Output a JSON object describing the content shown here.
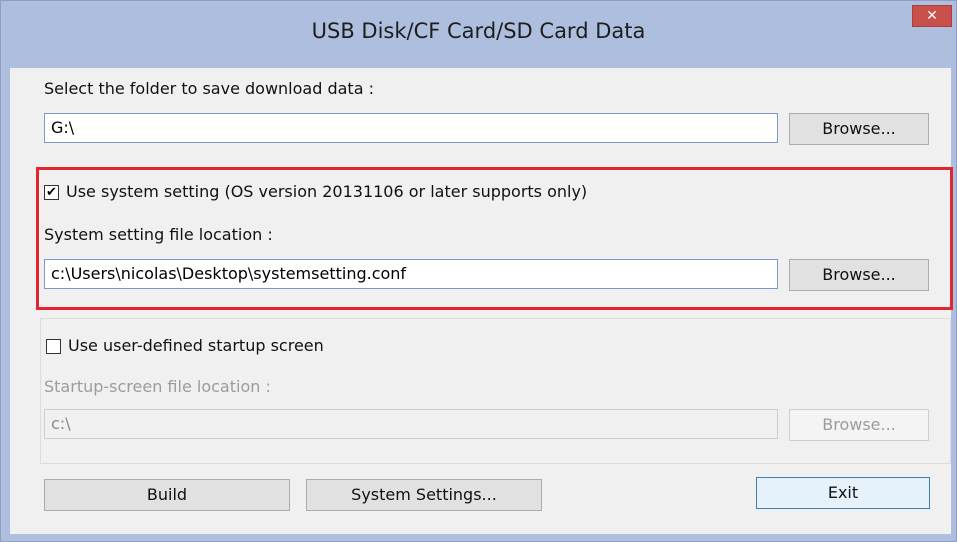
{
  "window": {
    "title": "USB Disk/CF Card/SD Card Data",
    "close_glyph": "✕"
  },
  "download": {
    "label": "Select the folder to save download data :",
    "value": "G:\\",
    "browse_label": "Browse..."
  },
  "system_setting": {
    "checkbox_label": "Use system setting (OS version 20131106 or later supports only)",
    "checked": true,
    "location_label": "System setting file location :",
    "value": "c:\\Users\\nicolas\\Desktop\\systemsetting.conf",
    "browse_label": "Browse..."
  },
  "startup": {
    "checkbox_label": "Use user-defined startup screen",
    "checked": false,
    "location_label": "Startup-screen file location :",
    "value": "c:\\",
    "browse_label": "Browse..."
  },
  "buttons": {
    "build": "Build",
    "system_settings": "System Settings...",
    "exit": "Exit"
  },
  "colors": {
    "highlight_border": "#e0262e",
    "titlebar": "#aebedf",
    "close_button": "#c7504a"
  }
}
